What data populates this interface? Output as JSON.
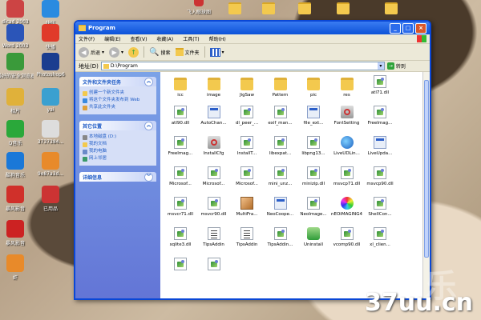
{
  "desktop": {
    "icons": [
      {
        "label": "dicad 2003",
        "color": "#c44"
      },
      {
        "label": "快压",
        "color": "#2a8be0"
      },
      {
        "label": "Word 2003",
        "color": "#2b55b8"
      },
      {
        "label": "快播",
        "color": "#e03a2a"
      },
      {
        "label": "最好的安全浏览器",
        "color": "#3a9a3a"
      },
      {
        "label": "Photoshop6",
        "color": "#1b3d8f"
      },
      {
        "label": "相片",
        "color": "#e0b13a"
      },
      {
        "label": "yai",
        "color": "#3aa0d0"
      },
      {
        "label": "Q音乐",
        "color": "#2aa83a"
      },
      {
        "label": "3737384...",
        "color": "#ddd"
      },
      {
        "label": "酷狗音乐",
        "color": "#1a78d8"
      },
      {
        "label": "9e87a3d...",
        "color": "#e88a2a"
      },
      {
        "label": "暴风影音",
        "color": "#d0302a"
      },
      {
        "label": "已用品",
        "color": "#c33"
      },
      {
        "label": "暴风影音",
        "color": "#c22"
      },
      {
        "label": "虾",
        "color": "#e88a2a"
      }
    ],
    "top_labels": [
      "飞入眼球图"
    ]
  },
  "window": {
    "title": "Program",
    "menu": [
      "文件(F)",
      "编辑(E)",
      "查看(V)",
      "收藏(A)",
      "工具(T)",
      "帮助(H)"
    ],
    "toolbar": {
      "back": "后退",
      "search": "搜索",
      "folders": "文件夹"
    },
    "address_label": "地址(D)",
    "address_value": "D:\\Program",
    "go_label": "转到",
    "tasks": {
      "title": "文件和文件夹任务",
      "items": [
        "创建一个新文件夹",
        "将这个文件夹发布到 Web",
        "共享此文件夹"
      ]
    },
    "places": {
      "title": "其它位置",
      "items": [
        "本地磁盘 (D:)",
        "我的文档",
        "我的电脑",
        "网上邻居"
      ]
    },
    "details": {
      "title": "详细信息"
    },
    "files": [
      {
        "name": "icc",
        "type": "folder"
      },
      {
        "name": "image",
        "type": "folder"
      },
      {
        "name": "JigSaw",
        "type": "folder"
      },
      {
        "name": "Pattern",
        "type": "folder"
      },
      {
        "name": "pic",
        "type": "folder"
      },
      {
        "name": "res",
        "type": "folder"
      },
      {
        "name": "atl71.dll",
        "type": "dll"
      },
      {
        "name": "atl90.dll",
        "type": "dll"
      },
      {
        "name": "AutoChan...",
        "type": "exe"
      },
      {
        "name": "dl_peer_...",
        "type": "dll"
      },
      {
        "name": "exif_man...",
        "type": "dll"
      },
      {
        "name": "file_ext...",
        "type": "exe"
      },
      {
        "name": "FontSetting",
        "type": "setting"
      },
      {
        "name": "FreeImag...",
        "type": "dll"
      },
      {
        "name": "FreeImag...",
        "type": "dll"
      },
      {
        "name": "InstallCfg",
        "type": "setting"
      },
      {
        "name": "InstallT...",
        "type": "dll"
      },
      {
        "name": "libexpat...",
        "type": "dll"
      },
      {
        "name": "libpng13...",
        "type": "dll"
      },
      {
        "name": "LiveUDLin...",
        "type": "globe"
      },
      {
        "name": "LiveUpda...",
        "type": "exe"
      },
      {
        "name": "Microsof...",
        "type": "dll"
      },
      {
        "name": "Microsof...",
        "type": "dll"
      },
      {
        "name": "Microsof...",
        "type": "dll"
      },
      {
        "name": "mini_unz...",
        "type": "dll"
      },
      {
        "name": "minizip.dll",
        "type": "dll"
      },
      {
        "name": "msvcp71.dll",
        "type": "dll"
      },
      {
        "name": "msvcp90.dll",
        "type": "dll"
      },
      {
        "name": "msvcr71.dll",
        "type": "dll"
      },
      {
        "name": "msvcr90.dll",
        "type": "dll"
      },
      {
        "name": "MultiFra...",
        "type": "img"
      },
      {
        "name": "NeoCoope...",
        "type": "exe"
      },
      {
        "name": "NeoImage...",
        "type": "dll"
      },
      {
        "name": "nEOiMAGING4",
        "type": "color"
      },
      {
        "name": "ShellCon...",
        "type": "dll"
      },
      {
        "name": "sqlite3.dll",
        "type": "dll"
      },
      {
        "name": "TipsAddin",
        "type": "txt"
      },
      {
        "name": "TipsAddin",
        "type": "txt"
      },
      {
        "name": "TipsAddin...",
        "type": "dll"
      },
      {
        "name": "Uninstall",
        "type": "recycle"
      },
      {
        "name": "vcomp90.dll",
        "type": "dll"
      },
      {
        "name": "xl_clien...",
        "type": "dll"
      },
      {
        "name": "",
        "type": "dll"
      },
      {
        "name": "",
        "type": "dll"
      }
    ]
  },
  "watermark": "37uu.cn"
}
